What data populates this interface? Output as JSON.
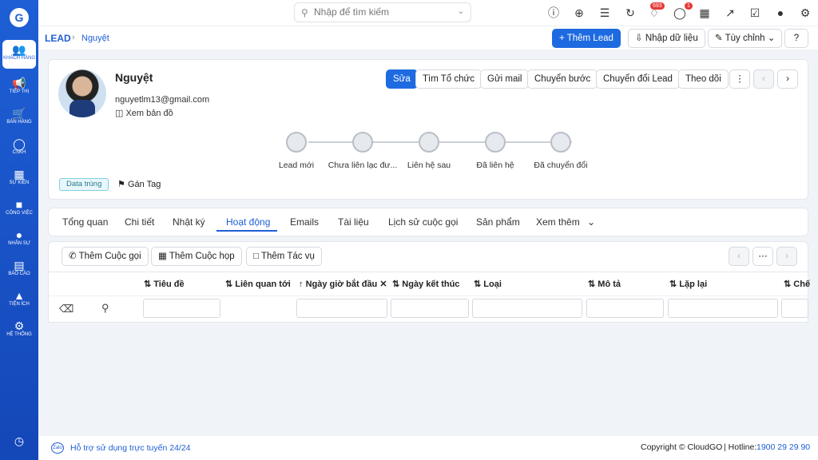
{
  "sidebar": {
    "items": [
      {
        "label": "KHÁCH HÀNG",
        "icon": "users-icon"
      },
      {
        "label": "TIẾP THỊ",
        "icon": "megaphone-icon"
      },
      {
        "label": "BÁN HÀNG",
        "icon": "cart-icon"
      },
      {
        "label": "CSKH",
        "icon": "lifebuoy-icon"
      },
      {
        "label": "SỰ KIỆN",
        "icon": "calendar-icon"
      },
      {
        "label": "CÔNG VIỆC",
        "icon": "briefcase-icon"
      },
      {
        "label": "NHÂN SỰ",
        "icon": "person-icon"
      },
      {
        "label": "BÁO CÁO",
        "icon": "report-icon"
      },
      {
        "label": "TIỆN ÍCH",
        "icon": "utilities-icon"
      },
      {
        "label": "HỆ THỐNG",
        "icon": "wrench-icon"
      }
    ]
  },
  "search": {
    "placeholder": "Nhập để tìm kiếm"
  },
  "notifications": {
    "bell_count": "693",
    "chat_count": "1"
  },
  "breadcrumb": {
    "root": "LEAD",
    "current": "Nguyệt"
  },
  "header_actions": {
    "add_lead": "Thêm Lead",
    "import": "Nhập dữ liệu",
    "customize": "Tùy chỉnh"
  },
  "profile": {
    "name": "Nguyệt",
    "email": "nguyetlm13@gmail.com",
    "map_link": "Xem bản đồ",
    "tag_badge": "Data trùng",
    "assign_tag": "Gán Tag"
  },
  "profile_actions": {
    "edit": "Sửa",
    "find_org": "Tìm Tổ chức",
    "send_mail": "Gửi mail",
    "transfer_step": "Chuyển bước",
    "convert_lead": "Chuyển đổi Lead",
    "follow": "Theo dõi"
  },
  "pipeline": {
    "steps": [
      "Lead mới",
      "Chưa liên lạc đư...",
      "Liên hệ sau",
      "Đã liên hệ",
      "Đã chuyển đổi"
    ]
  },
  "tabs": [
    "Tổng quan",
    "Chi tiết",
    "Nhật ký",
    "Hoạt động",
    "Emails",
    "Tài liệu",
    "Lịch sử cuộc gọi",
    "Sản phẩm",
    "Xem thêm"
  ],
  "active_tab": "Hoạt động",
  "activity_actions": {
    "add_call": "Thêm Cuộc gọi",
    "add_meeting": "Thêm Cuộc họp",
    "add_task": "Thêm Tác vụ"
  },
  "table": {
    "columns": [
      "Tiêu đề",
      "Liên quan tới",
      "Ngày giờ bắt đầu",
      "Ngày kết thúc",
      "Loại",
      "Mô tả",
      "Lặp lại",
      "Chế"
    ]
  },
  "footer": {
    "support": "Hỗ trợ sử dụng trực tuyến 24/24",
    "copyright": "Copyright © CloudGO",
    "hotline_label": "Hotline:",
    "hotline": "1900 29 29 90"
  },
  "colors": {
    "primary": "#1e6ae0",
    "sidebar": "#1e5fd6",
    "badge": "#e53935"
  }
}
